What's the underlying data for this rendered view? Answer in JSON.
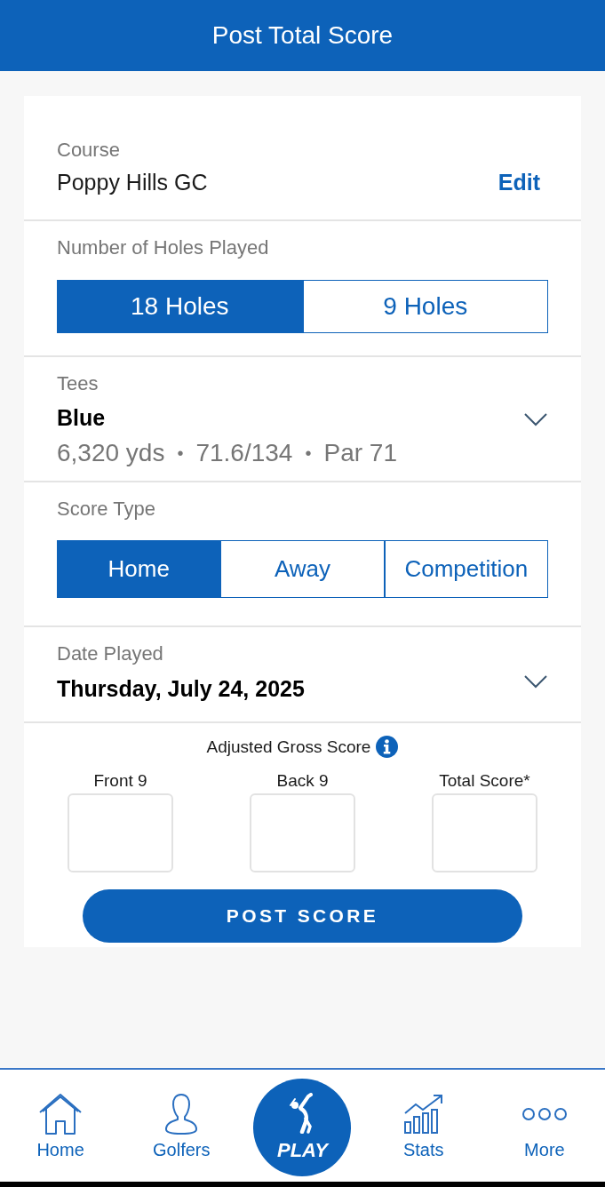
{
  "header": {
    "title": "Post Total Score"
  },
  "course": {
    "label": "Course",
    "value": "Poppy Hills GC",
    "action": "Edit"
  },
  "holes": {
    "label": "Number of Holes Played",
    "options": [
      {
        "label": "18 Holes",
        "selected": true
      },
      {
        "label": "9 Holes",
        "selected": false
      }
    ]
  },
  "tees": {
    "label": "Tees",
    "value": "Blue",
    "details": [
      "6,320 yds",
      "71.6/134",
      "Par 71"
    ],
    "separator": "•"
  },
  "score_type": {
    "label": "Score Type",
    "options": [
      {
        "label": "Home",
        "selected": true
      },
      {
        "label": "Away",
        "selected": false
      },
      {
        "label": "Competition",
        "selected": false
      }
    ]
  },
  "date": {
    "label": "Date Played",
    "value": "Thursday, July 24, 2025"
  },
  "scores": {
    "title": "Adjusted Gross Score",
    "fields": [
      {
        "label": "Front 9"
      },
      {
        "label": "Back 9"
      },
      {
        "label": "Total Score*"
      }
    ],
    "button": "POST SCORE"
  },
  "nav": [
    {
      "kind": "tab",
      "label": "Home"
    },
    {
      "kind": "tab",
      "label": "Golfers"
    },
    {
      "kind": "play",
      "label": "PLAY"
    },
    {
      "kind": "tab",
      "label": "Stats"
    },
    {
      "kind": "tab",
      "label": "More"
    }
  ]
}
